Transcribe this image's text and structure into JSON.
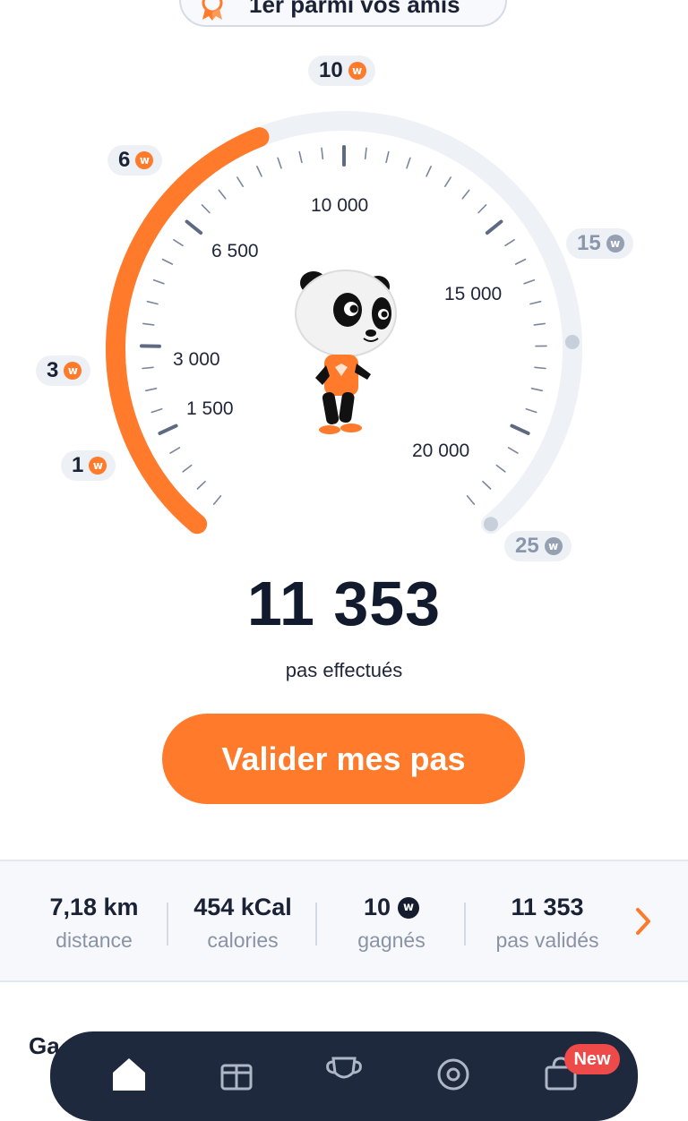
{
  "rank": {
    "text": "1er parmi vos amis",
    "icon": "medal-icon"
  },
  "gauge": {
    "current_steps": 11353,
    "max_steps": 25000,
    "accent_color": "#ff7a2b",
    "track_color": "#eef1f6",
    "rewards": [
      {
        "label": "1",
        "steps": 0,
        "reached": true
      },
      {
        "label": "3",
        "steps": 3000,
        "reached": true
      },
      {
        "label": "6",
        "steps": 6500,
        "reached": true
      },
      {
        "label": "10",
        "steps": 10000,
        "reached": true
      },
      {
        "label": "15",
        "steps": 15000,
        "reached": false
      },
      {
        "label": "25",
        "steps": 20000,
        "reached": false
      }
    ],
    "tick_labels": [
      "1 500",
      "3 000",
      "6 500",
      "10 000",
      "15 000",
      "20 000"
    ],
    "coin_symbol": "w"
  },
  "steps": {
    "count": "11 353",
    "label": "pas effectués"
  },
  "validate_button": {
    "label": "Valider mes pas"
  },
  "stats": [
    {
      "value": "7,18 km",
      "label": "distance",
      "coin": false
    },
    {
      "value": "454 kCal",
      "label": "calories",
      "coin": false
    },
    {
      "value": "10",
      "label": "gagnés",
      "coin": true
    },
    {
      "value": "11 353",
      "label": "pas validés",
      "coin": false
    }
  ],
  "section": {
    "title": "Ga"
  },
  "tabbar": {
    "tabs": [
      {
        "name": "home-icon"
      },
      {
        "name": "gift-icon"
      },
      {
        "name": "trophy-icon"
      },
      {
        "name": "target-icon"
      },
      {
        "name": "shop-icon"
      }
    ],
    "new_badge": "New"
  }
}
